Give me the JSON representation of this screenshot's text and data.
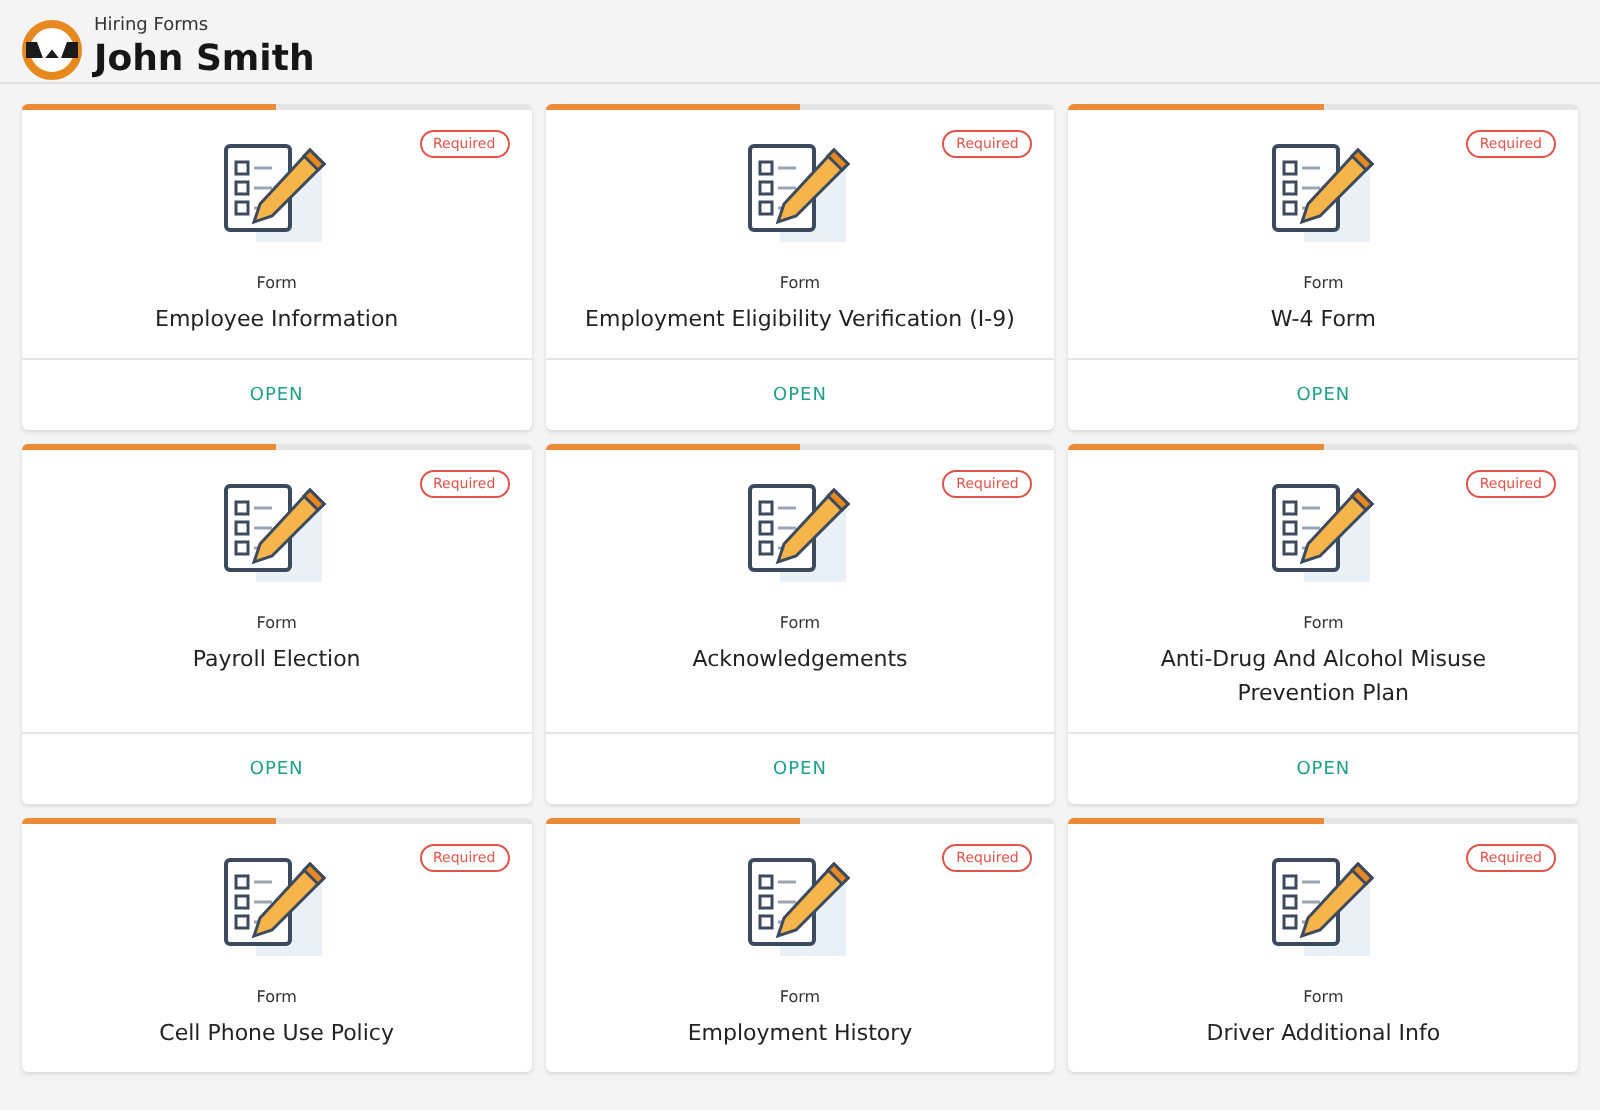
{
  "header": {
    "subtitle": "Hiring Forms",
    "title": "John Smith"
  },
  "cards": [
    {
      "progress": {
        "level": 0.5
      },
      "badge": "Required",
      "type": "Form",
      "title": "Employee Information",
      "action": "OPEN"
    },
    {
      "progress": {
        "level": 0.5
      },
      "badge": "Required",
      "type": "Form",
      "title": "Employment Eligibility Verification (I-9)",
      "action": "OPEN"
    },
    {
      "progress": {
        "level": 0.5
      },
      "badge": "Required",
      "type": "Form",
      "title": "W-4 Form",
      "action": "OPEN"
    },
    {
      "progress": {
        "level": 0.5
      },
      "badge": "Required",
      "type": "Form",
      "title": "Payroll Election",
      "action": "OPEN"
    },
    {
      "progress": {
        "level": 0.5
      },
      "badge": "Required",
      "type": "Form",
      "title": "Acknowledgements",
      "action": "OPEN"
    },
    {
      "progress": {
        "level": 0.5
      },
      "badge": "Required",
      "type": "Form",
      "title": "Anti-Drug And Alcohol Misuse Prevention Plan",
      "action": "OPEN"
    },
    {
      "progress": {
        "level": 0.5
      },
      "badge": "Required",
      "type": "Form",
      "title": "Cell Phone Use Policy"
    },
    {
      "progress": {
        "level": 0.5
      },
      "badge": "Required",
      "type": "Form",
      "title": "Employment History"
    },
    {
      "progress": {
        "level": 0.5
      },
      "badge": "Required",
      "type": "Form",
      "title": "Driver Additional Info"
    }
  ]
}
